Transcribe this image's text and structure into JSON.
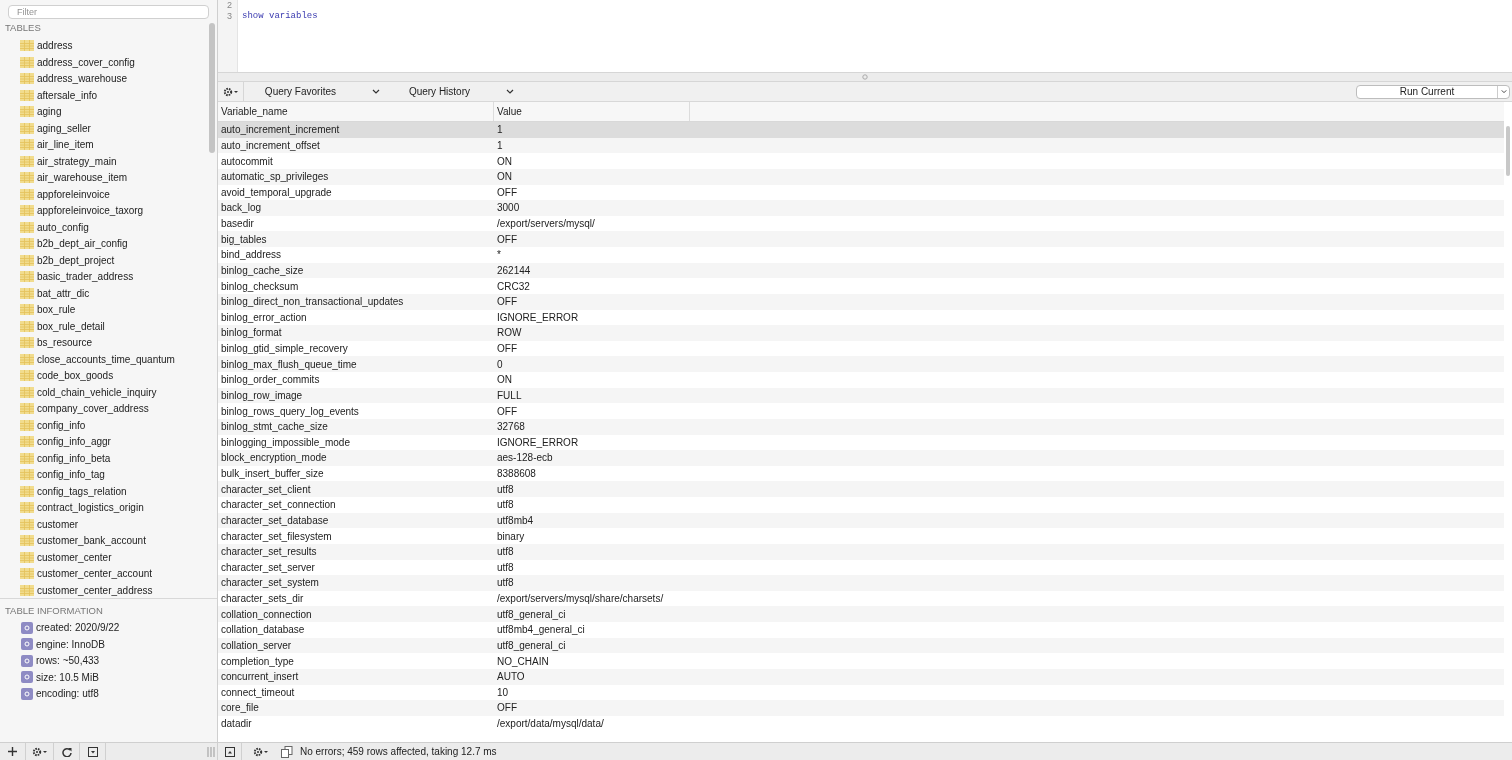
{
  "sidebar": {
    "filter": {
      "placeholder": "Filter"
    },
    "tables_heading": "TABLES",
    "tables": [
      "address",
      "address_cover_config",
      "address_warehouse",
      "aftersale_info",
      "aging",
      "aging_seller",
      "air_line_item",
      "air_strategy_main",
      "air_warehouse_item",
      "appforeleinvoice",
      "appforeleinvoice_taxorg",
      "auto_config",
      "b2b_dept_air_config",
      "b2b_dept_project",
      "basic_trader_address",
      "bat_attr_dic",
      "box_rule",
      "box_rule_detail",
      "bs_resource",
      "close_accounts_time_quantum",
      "code_box_goods",
      "cold_chain_vehicle_inquiry",
      "company_cover_address",
      "config_info",
      "config_info_aggr",
      "config_info_beta",
      "config_info_tag",
      "config_tags_relation",
      "contract_logistics_origin",
      "customer",
      "customer_bank_account",
      "customer_center",
      "customer_center_account",
      "customer_center_address"
    ],
    "info_heading": "TABLE INFORMATION",
    "info": [
      "created: 2020/9/22",
      "engine: InnoDB",
      "rows: ~50,433",
      "size: 10.5 MiB",
      "encoding: utf8"
    ]
  },
  "editor": {
    "lines": [
      {
        "number": "2"
      },
      {
        "number": "3",
        "code": "show variables"
      }
    ]
  },
  "toolbar": {
    "favorites": "Query Favorites",
    "history": "Query History",
    "run": "Run Current"
  },
  "table": {
    "columns": [
      "Variable_name",
      "Value"
    ],
    "rows": [
      {
        "name": "auto_increment_increment",
        "value": "1",
        "selected": true
      },
      {
        "name": "auto_increment_offset",
        "value": "1",
        "selected": false
      },
      {
        "name": "autocommit",
        "value": "ON",
        "selected": false
      },
      {
        "name": "automatic_sp_privileges",
        "value": "ON",
        "selected": false
      },
      {
        "name": "avoid_temporal_upgrade",
        "value": "OFF",
        "selected": false
      },
      {
        "name": "back_log",
        "value": "3000",
        "selected": false
      },
      {
        "name": "basedir",
        "value": "/export/servers/mysql/",
        "selected": false
      },
      {
        "name": "big_tables",
        "value": "OFF",
        "selected": false
      },
      {
        "name": "bind_address",
        "value": "*",
        "selected": false
      },
      {
        "name": "binlog_cache_size",
        "value": "262144",
        "selected": false
      },
      {
        "name": "binlog_checksum",
        "value": "CRC32",
        "selected": false
      },
      {
        "name": "binlog_direct_non_transactional_updates",
        "value": "OFF",
        "selected": false
      },
      {
        "name": "binlog_error_action",
        "value": "IGNORE_ERROR",
        "selected": false
      },
      {
        "name": "binlog_format",
        "value": "ROW",
        "selected": false
      },
      {
        "name": "binlog_gtid_simple_recovery",
        "value": "OFF",
        "selected": false
      },
      {
        "name": "binlog_max_flush_queue_time",
        "value": "0",
        "selected": false
      },
      {
        "name": "binlog_order_commits",
        "value": "ON",
        "selected": false
      },
      {
        "name": "binlog_row_image",
        "value": "FULL",
        "selected": false
      },
      {
        "name": "binlog_rows_query_log_events",
        "value": "OFF",
        "selected": false
      },
      {
        "name": "binlog_stmt_cache_size",
        "value": "32768",
        "selected": false
      },
      {
        "name": "binlogging_impossible_mode",
        "value": "IGNORE_ERROR",
        "selected": false
      },
      {
        "name": "block_encryption_mode",
        "value": "aes-128-ecb",
        "selected": false
      },
      {
        "name": "bulk_insert_buffer_size",
        "value": "8388608",
        "selected": false
      },
      {
        "name": "character_set_client",
        "value": "utf8",
        "selected": false
      },
      {
        "name": "character_set_connection",
        "value": "utf8",
        "selected": false
      },
      {
        "name": "character_set_database",
        "value": "utf8mb4",
        "selected": false
      },
      {
        "name": "character_set_filesystem",
        "value": "binary",
        "selected": false
      },
      {
        "name": "character_set_results",
        "value": "utf8",
        "selected": false
      },
      {
        "name": "character_set_server",
        "value": "utf8",
        "selected": false
      },
      {
        "name": "character_set_system",
        "value": "utf8",
        "selected": false
      },
      {
        "name": "character_sets_dir",
        "value": "/export/servers/mysql/share/charsets/",
        "selected": false
      },
      {
        "name": "collation_connection",
        "value": "utf8_general_ci",
        "selected": false
      },
      {
        "name": "collation_database",
        "value": "utf8mb4_general_ci",
        "selected": false
      },
      {
        "name": "collation_server",
        "value": "utf8_general_ci",
        "selected": false
      },
      {
        "name": "completion_type",
        "value": "NO_CHAIN",
        "selected": false
      },
      {
        "name": "concurrent_insert",
        "value": "AUTO",
        "selected": false
      },
      {
        "name": "connect_timeout",
        "value": "10",
        "selected": false
      },
      {
        "name": "core_file",
        "value": "OFF",
        "selected": false
      },
      {
        "name": "datadir",
        "value": "/export/data/mysql/data/",
        "selected": false
      }
    ]
  },
  "status_bar": {
    "message": "No errors; 459 rows affected, taking 12.7 ms"
  }
}
